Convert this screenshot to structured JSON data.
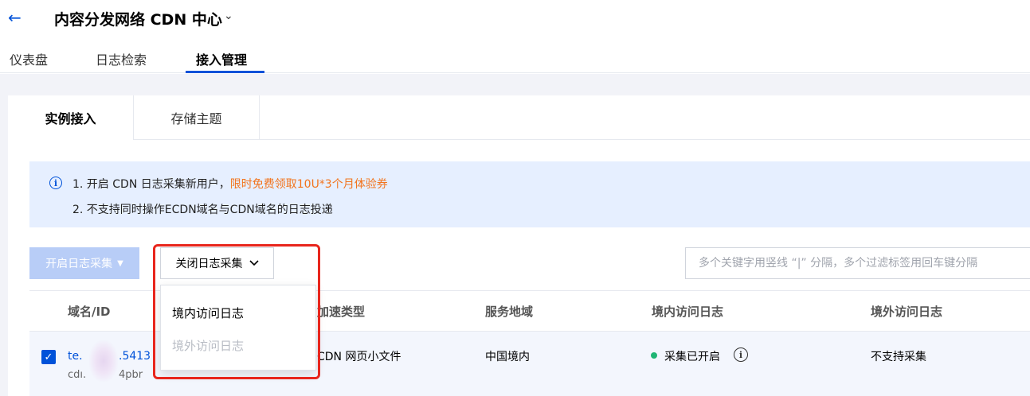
{
  "header": {
    "back_icon": "←",
    "title": "内容分发网络 CDN 中心",
    "chevron": "⌄"
  },
  "tabs": [
    {
      "label": "仪表盘"
    },
    {
      "label": "日志检索"
    },
    {
      "label": "接入管理"
    }
  ],
  "subtabs": [
    {
      "label": "实例接入"
    },
    {
      "label": "存储主题"
    }
  ],
  "notice": {
    "line1_prefix": "1. 开启 CDN 日志采集新用户，",
    "line1_highlight": "限时免费领取10U*3个月体验券",
    "line2": "2. 不支持同时操作ECDN域名与CDN域名的日志投递",
    "accent_color": "#f2741e"
  },
  "toolbar": {
    "open_label": "开启日志采集",
    "close_label": "关闭日志采集",
    "search_placeholder": "多个关键字用竖线 “|” 分隔，多个过滤标签用回车键分隔"
  },
  "dropdown": {
    "items": [
      {
        "label": "境内访问日志",
        "enabled": true
      },
      {
        "label": "境外访问日志",
        "enabled": false
      }
    ]
  },
  "table": {
    "headers": [
      "域名/ID",
      "加速类型",
      "服务地域",
      "境内访问日志",
      "境外访问日志"
    ],
    "rows": [
      {
        "domain_main_left": "te.",
        "domain_main_right": ".5413",
        "domain_sub_left": "cdı.",
        "domain_sub_right": "4pbr",
        "type": "CDN 网页小文件",
        "region": "中国境内",
        "domestic_status": "采集已开启",
        "overseas_status": "不支持采集",
        "checked": true
      }
    ]
  },
  "colors": {
    "primary": "#0052d9",
    "status_green": "#1fb574",
    "highlight_red": "#e8261d"
  }
}
